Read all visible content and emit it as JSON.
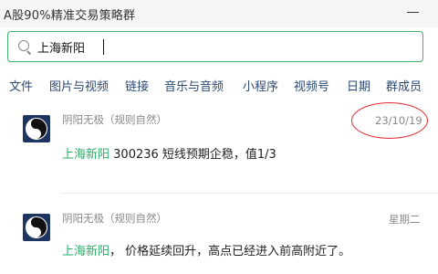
{
  "window": {
    "title": "A股90%精准交易策略群"
  },
  "search": {
    "value": "上海新阳"
  },
  "tabs": [
    "文件",
    "图片与视频",
    "链接",
    "音乐与音频",
    "小程序",
    "视频号",
    "日期",
    "群成员"
  ],
  "messages": [
    {
      "sender": "阴阳无极（规则自然）",
      "date": "23/10/19",
      "highlight": "上海新阳",
      "text": " 300236  短线预期企稳，值1/3"
    },
    {
      "sender": "阴阳无极（规则自然）",
      "date": "星期二",
      "highlight": "上海新阳",
      "text": "， 价格延续回升，高点已经进入前高附近了。"
    }
  ],
  "colors": {
    "accent": "#2aae67",
    "link": "#2d4a73",
    "annotation": "#e0282e"
  },
  "icons": {
    "search": "search-icon",
    "avatar": "yin-yang-icon",
    "minimize": "minimize-icon"
  }
}
